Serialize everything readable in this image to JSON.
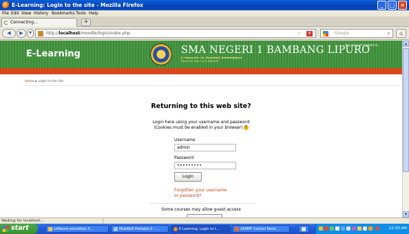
{
  "window": {
    "title": "E-Learning: Login to the site - Mozilla Firefox"
  },
  "menu": [
    "File",
    "Edit",
    "View",
    "History",
    "Bookmarks",
    "Tools",
    "Help"
  ],
  "tab": {
    "label": "Connecting..."
  },
  "nav": {
    "url_prefix": "http://",
    "url_host": "localhost",
    "url_path": "/moodle/login/index.php",
    "search_placeholder": "Google"
  },
  "page": {
    "brand": "E-Learning",
    "school_name": "SMA NEGERI 1 BAMBANG LIPURO",
    "school_address": "Jl. Samas Km. 18, Mulyodadi, Bambanglipuro",
    "school_contact": "Bantul  DIY  Telp. 0274 3694028",
    "login_status": "You are not logged in.",
    "breadcrumb_home": "Home",
    "breadcrumb_separator": "►",
    "breadcrumb_current": "Login to the site",
    "heading": "Returning to this web site?",
    "intro_line1": "Login here using your username and password",
    "intro_line2": "(Cookies must be enabled in your browser)",
    "username_label": "Username",
    "username_value": "admin",
    "password_label": "Password",
    "password_value": "•••••••••",
    "login_button": "Login",
    "forgot_line1": "Forgotten your username",
    "forgot_line2": "or password?",
    "guest_text": "Some courses may allow guest access"
  },
  "status": {
    "text": "Waiting for localhost..."
  },
  "taskbar": {
    "start": "start",
    "tasks": [
      {
        "label": "software penelitian 3...",
        "color": "#f3c54b"
      },
      {
        "label": "MobiReS Portable II - ...",
        "color": "#9ec7f0"
      },
      {
        "label": "E-Learning: Login to t...",
        "color": "#f08a2c"
      },
      {
        "label": "XAMPP Control Panel ...",
        "color": "#f06a2c"
      }
    ],
    "clock": "12:20 AM"
  },
  "colors": {
    "banner_green": "#4a9a45",
    "accent_orange": "#d9481c",
    "link_red": "#c2401a",
    "xp_blue": "#245edb"
  }
}
